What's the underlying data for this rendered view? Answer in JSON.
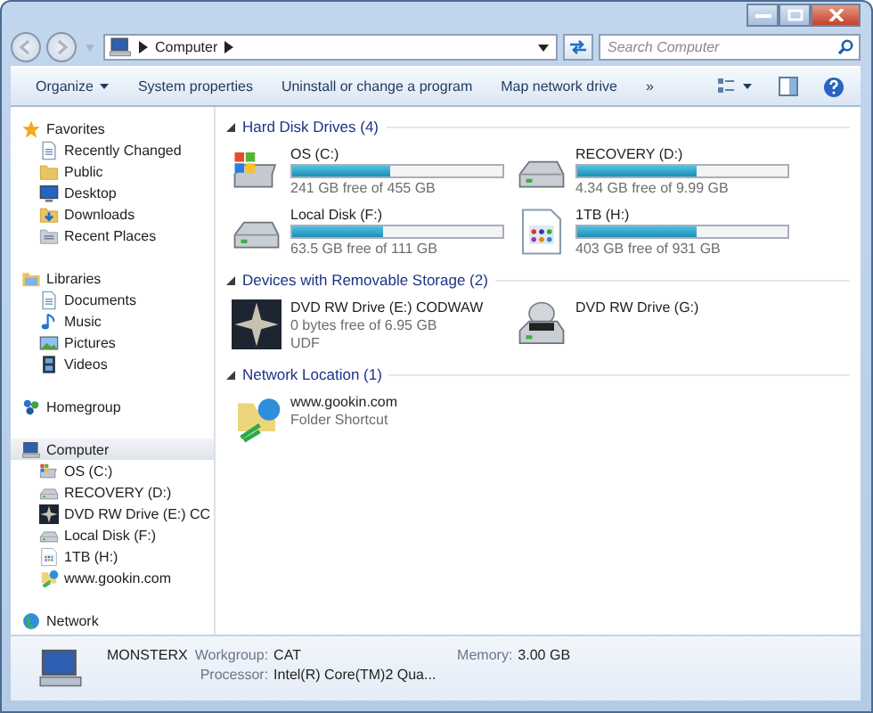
{
  "address_bar": {
    "crumbs": [
      "Computer"
    ]
  },
  "search": {
    "placeholder": "Search Computer"
  },
  "toolbar": {
    "buttons": [
      {
        "label": "Organize",
        "dropdown": true
      },
      {
        "label": "System properties",
        "dropdown": false
      },
      {
        "label": "Uninstall or change a program",
        "dropdown": false
      },
      {
        "label": "Map network drive",
        "dropdown": false
      }
    ],
    "overflow": "»"
  },
  "sidebar": {
    "groups": [
      {
        "label": "Favorites",
        "selected": false,
        "children": [
          {
            "label": "Recently Changed",
            "selected": false
          },
          {
            "label": "Public",
            "selected": false
          },
          {
            "label": "Desktop",
            "selected": false
          },
          {
            "label": "Downloads",
            "selected": false
          },
          {
            "label": "Recent Places",
            "selected": false
          }
        ]
      },
      {
        "label": "Libraries",
        "selected": false,
        "children": [
          {
            "label": "Documents",
            "selected": false
          },
          {
            "label": "Music",
            "selected": false
          },
          {
            "label": "Pictures",
            "selected": false
          },
          {
            "label": "Videos",
            "selected": false
          }
        ]
      },
      {
        "label": "Homegroup",
        "selected": false
      },
      {
        "label": "Computer",
        "selected": true,
        "children": [
          {
            "label": "OS (C:)",
            "selected": false
          },
          {
            "label": "RECOVERY (D:)",
            "selected": false
          },
          {
            "label": "DVD RW Drive (E:) CC",
            "selected": false
          },
          {
            "label": "Local Disk (F:)",
            "selected": false
          },
          {
            "label": "1TB (H:)",
            "selected": false
          },
          {
            "label": "www.gookin.com",
            "selected": false
          }
        ]
      },
      {
        "label": "Network",
        "selected": false
      }
    ]
  },
  "sections": [
    {
      "title": "Hard Disk Drives (4)",
      "expanded": true,
      "items": [
        {
          "kind": "system-drive",
          "name": "OS (C:)",
          "level": 0.47,
          "lines": [
            "241 GB free of 455 GB"
          ]
        },
        {
          "kind": "drive",
          "name": "RECOVERY (D:)",
          "level": 0.57,
          "lines": [
            "4.34 GB free of 9.99 GB"
          ]
        },
        {
          "kind": "drive",
          "name": "Local Disk (F:)",
          "level": 0.43,
          "lines": [
            "63.5 GB free of 111 GB"
          ]
        },
        {
          "kind": "file-drive",
          "name": "1TB (H:)",
          "level": 0.57,
          "lines": [
            "403 GB free of 931 GB"
          ]
        }
      ]
    },
    {
      "title": "Devices with Removable Storage (2)",
      "expanded": true,
      "items": [
        {
          "kind": "star-disc",
          "name": "DVD RW Drive (E:) CODWAW",
          "lines": [
            "0 bytes free of 6.95 GB",
            "UDF"
          ]
        },
        {
          "kind": "dvd-drive",
          "name": "DVD RW Drive (G:)"
        }
      ]
    },
    {
      "title": "Network Location (1)",
      "expanded": true,
      "items": [
        {
          "kind": "web-folder",
          "name": "www.gookin.com",
          "lines": [
            "Folder Shortcut"
          ]
        }
      ]
    }
  ],
  "details": {
    "name": "MONSTERX",
    "fields": [
      {
        "label": "Workgroup:",
        "value": "CAT"
      },
      {
        "label": "Memory:",
        "value": "3.00 GB"
      },
      {
        "label": "Processor:",
        "value": "Intel(R) Core(TM)2 Qua..."
      }
    ]
  }
}
